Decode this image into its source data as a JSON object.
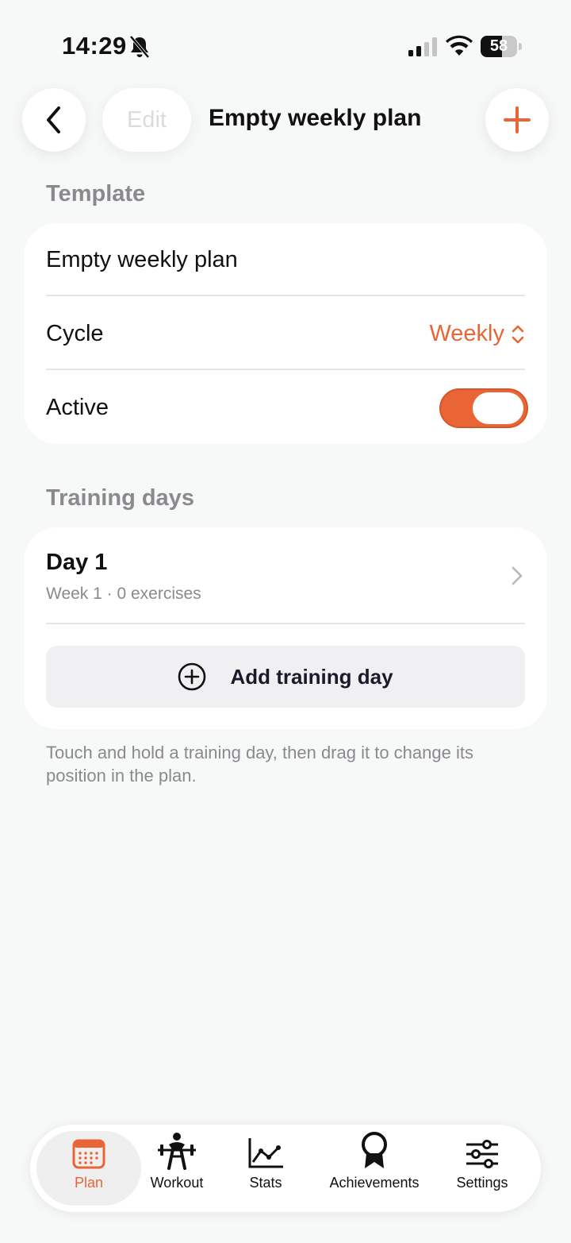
{
  "status_bar": {
    "time": "14:29",
    "battery_level": "58",
    "icons": [
      "bell-slash-icon",
      "cellular-signal-icon",
      "wifi-icon",
      "battery-icon"
    ]
  },
  "nav": {
    "edit_label": "Edit",
    "title": "Empty weekly plan",
    "icons": [
      "back-chevron-icon",
      "plus-icon"
    ]
  },
  "template_section": {
    "label": "Template",
    "name": "Empty weekly plan",
    "cycle_label": "Cycle",
    "cycle_value": "Weekly",
    "active_label": "Active",
    "active_on": true
  },
  "training_section": {
    "label": "Training days",
    "days": [
      {
        "title": "Day 1",
        "subtitle": "Week 1 · 0 exercises"
      }
    ],
    "add_label": "Add training day",
    "hint": "Touch and hold a training day, then drag it to change its position in the plan."
  },
  "tabs": [
    {
      "label": "Plan",
      "icon": "calendar-icon",
      "active": true
    },
    {
      "label": "Workout",
      "icon": "weightlifter-icon",
      "active": false
    },
    {
      "label": "Stats",
      "icon": "line-chart-icon",
      "active": false
    },
    {
      "label": "Achievements",
      "icon": "award-ribbon-icon",
      "active": false
    },
    {
      "label": "Settings",
      "icon": "sliders-icon",
      "active": false
    }
  ],
  "colors": {
    "accent": "#ea6535",
    "background": "#f7f8f8",
    "card": "#ffffff",
    "secondary_text": "#8a8a8e"
  }
}
